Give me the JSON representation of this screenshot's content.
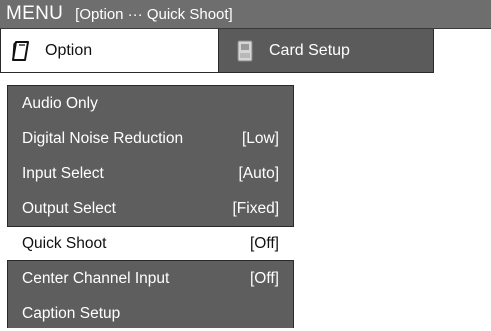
{
  "header": {
    "menu_label": "MENU",
    "path": "[Option ··· Quick Shoot]"
  },
  "tabs": [
    {
      "label": "Option",
      "icon": "notepad-icon",
      "active": true
    },
    {
      "label": "Card Setup",
      "icon": "card-icon",
      "active": false
    }
  ],
  "menu": {
    "items": [
      {
        "label": "Audio Only",
        "value": ""
      },
      {
        "label": "Digital Noise Reduction",
        "value": "[Low]"
      },
      {
        "label": "Input Select",
        "value": "[Auto]"
      },
      {
        "label": "Output Select",
        "value": "[Fixed]"
      },
      {
        "label": "Quick Shoot",
        "value": "[Off]",
        "selected": true
      },
      {
        "label": "Center Channel Input",
        "value": "[Off]"
      },
      {
        "label": "Caption Setup",
        "value": ""
      }
    ]
  },
  "colors": {
    "title_bar": "#6e6e6e",
    "panel": "#5e5e5e",
    "selected": "#ffffff"
  }
}
